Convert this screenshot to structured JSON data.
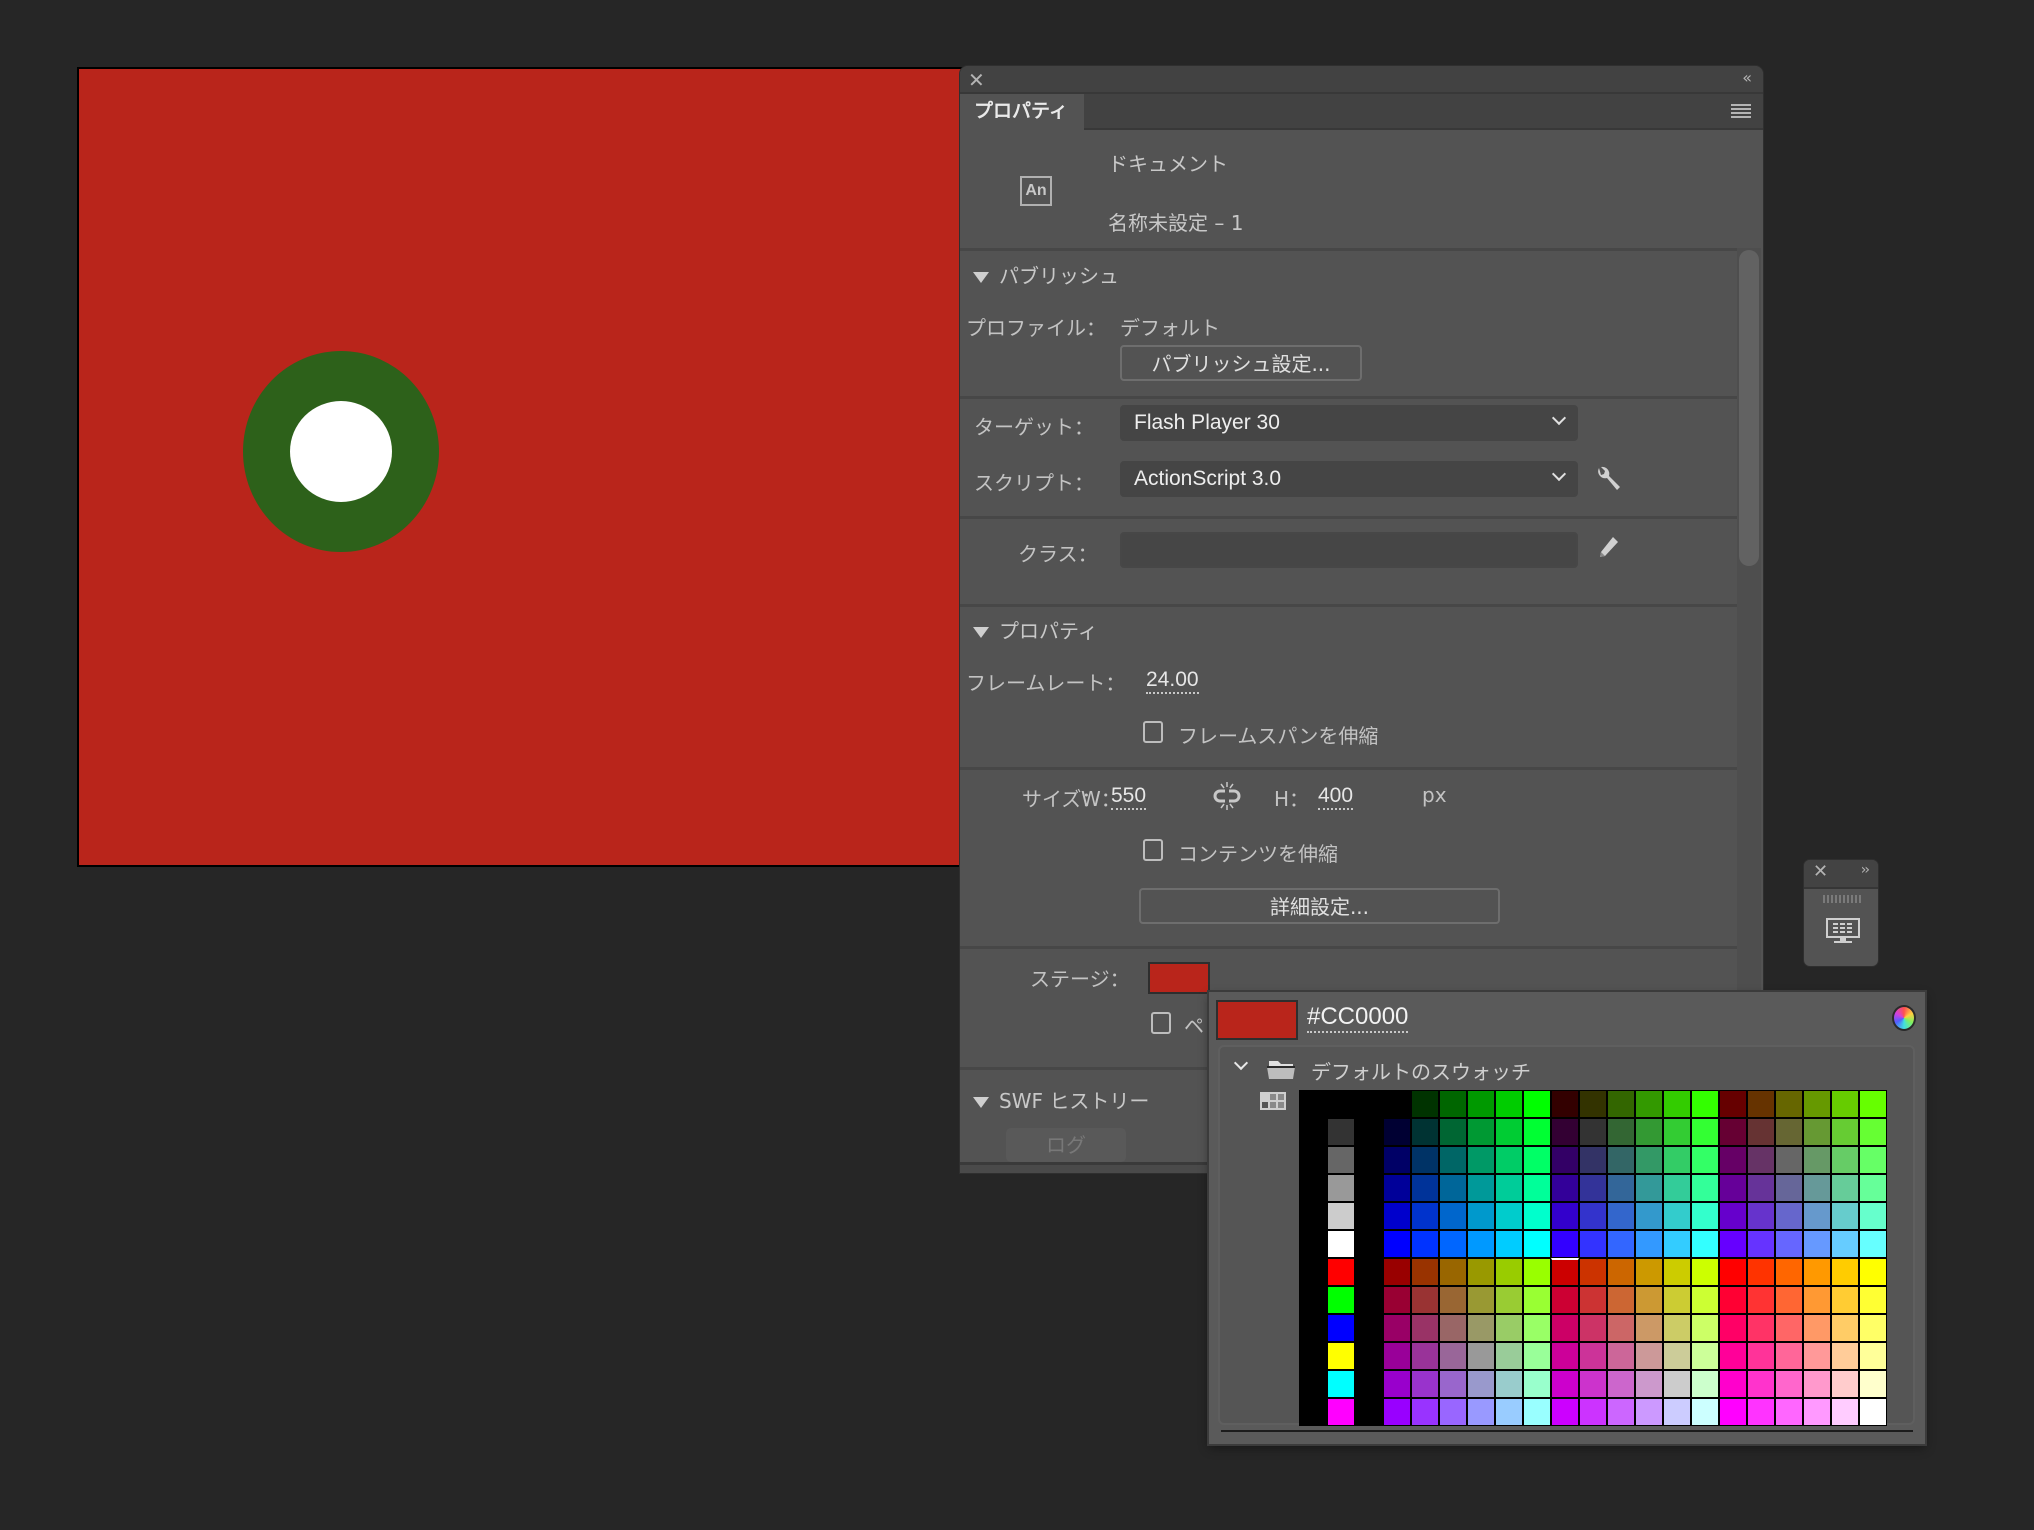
{
  "stage": {
    "background_color": "#CC0000",
    "shapes": [
      {
        "type": "ring",
        "fill": "#2D611A",
        "inner_fill": "#FFFFFF"
      }
    ]
  },
  "panel": {
    "close_icon": "close-icon",
    "collapse_icon": "double-chevron-left-icon",
    "tab_label": "プロパティ",
    "menu_icon": "hamburger-menu-icon",
    "doc_icon_text": "An",
    "doc_type": "ドキュメント",
    "doc_name": "名称未設定 – 1",
    "publish": {
      "section_title": "パブリッシュ",
      "profile_label": "プロファイル：",
      "profile_value": "デフォルト",
      "publish_settings_button": "パブリッシュ設定...",
      "target_label": "ターゲット：",
      "target_value": "Flash Player 30",
      "script_label": "スクリプト：",
      "script_value": "ActionScript 3.0",
      "class_label": "クラス：",
      "class_value": ""
    },
    "properties": {
      "section_title": "プロパティ",
      "framerate_label": "フレームレート：",
      "framerate_value": "24.00",
      "scale_spans_label": "フレームスパンを伸縮",
      "scale_spans_checked": false,
      "size_label": "サイズ：",
      "w_label": "W：",
      "w_value": "550",
      "h_label": "H：",
      "h_value": "400",
      "unit": "px",
      "scale_content_label": "コンテンツを伸縮",
      "scale_content_checked": false,
      "advanced_button": "詳細設定...",
      "stage_label": "ステージ：",
      "stage_color": "#CC0000",
      "paste_board_label_partial": "ペ"
    },
    "swf_history": {
      "section_title": "SWF ヒストリー",
      "log_button": "ログ"
    }
  },
  "mini_panel": {
    "close_icon": "close-icon",
    "expand_icon": "double-chevron-right-icon",
    "icon": "monitor-icon"
  },
  "swatch_popup": {
    "current_color": "#CC0000",
    "hex_value": "#CC0000",
    "color_wheel_icon": "color-wheel-icon",
    "library_name": "デフォルトのスウォッチ",
    "col1": [
      "#000000",
      "#333333",
      "#666666",
      "#999999",
      "#CCCCCC",
      "#FFFFFF",
      "#FF0000",
      "#00FF00",
      "#0000FF",
      "#FFFF00",
      "#00FFFF",
      "#FF00FF"
    ],
    "hex_steps": [
      "00",
      "33",
      "66",
      "99",
      "CC",
      "FF"
    ],
    "selected": "#CC0000"
  }
}
